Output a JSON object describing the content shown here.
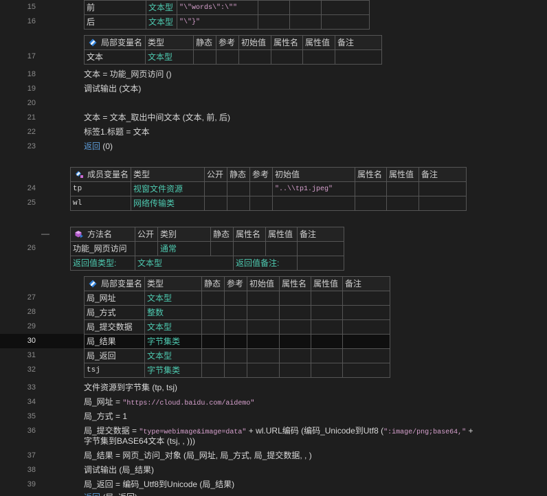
{
  "colors": {
    "background": "#1e1e1e",
    "line_number": "#8b8b8b",
    "code_text": "#d8d8d8",
    "type_text": "#4ec9b0",
    "string_text": "#d6a0cd",
    "keyword_text": "#5c9ad6",
    "grid_line": "#555555",
    "current_line": "#0f0f0f"
  },
  "icons": {
    "local_variables": "local-variable-icon",
    "member_variables": "member-variable-icon",
    "method": "method-icon",
    "fold": "fold-collapse-icon"
  },
  "param_table": {
    "rows": [
      {
        "line": "15",
        "name": "前",
        "type": "文本型",
        "value": "\"\\\"words\\\":\\\"\""
      },
      {
        "line": "16",
        "name": "后",
        "type": "文本型",
        "value": "\"\\\"}\""
      }
    ]
  },
  "sub_locals": {
    "headers": [
      "局部变量名",
      "类型",
      "静态",
      "参考",
      "初始值",
      "属性名",
      "属性值",
      "备注"
    ],
    "rows": [
      {
        "line": "17",
        "name": "文本",
        "type": "文本型"
      }
    ]
  },
  "code_a": {
    "l18": {
      "num": "18",
      "text": "文本 = 功能_网页访问 ()"
    },
    "l19": {
      "num": "19",
      "text": "调试输出 (文本)"
    },
    "l20": {
      "num": "20"
    },
    "l21": {
      "num": "21",
      "text": "文本 = 文本_取出中间文本 (文本, 前, 后)"
    },
    "l22": {
      "num": "22",
      "text": "标签1.标题 = 文本"
    },
    "l23": {
      "num": "23",
      "keyword": "返回",
      "text": " (0)"
    }
  },
  "member_vars": {
    "headers": [
      "成员变量名",
      "类型",
      "公开",
      "静态",
      "参考",
      "初始值",
      "属性名",
      "属性值",
      "备注"
    ],
    "rows": [
      {
        "line": "24",
        "name": "tp",
        "type": "视窗文件资源",
        "init": "\"..\\\\tp1.jpeg\""
      },
      {
        "line": "25",
        "name": "wl",
        "type": "网络传输类"
      }
    ]
  },
  "method": {
    "fold_marker": "—",
    "headers": [
      "方法名",
      "公开",
      "类别",
      "静态",
      "属性名",
      "属性值",
      "备注"
    ],
    "line": "26",
    "name": "功能_网页访问",
    "category": "通常",
    "return_type_label": "返回值类型:",
    "return_type": "文本型",
    "return_note_label": "返回值备注:"
  },
  "method_locals": {
    "headers": [
      "局部变量名",
      "类型",
      "静态",
      "参考",
      "初始值",
      "属性名",
      "属性值",
      "备注"
    ],
    "rows": [
      {
        "line": "27",
        "name": "局_网址",
        "type": "文本型"
      },
      {
        "line": "28",
        "name": "局_方式",
        "type": "整数"
      },
      {
        "line": "29",
        "name": "局_提交数据",
        "type": "文本型"
      },
      {
        "line": "30",
        "name": "局_结果",
        "type": "字节集类"
      },
      {
        "line": "31",
        "name": "局_返回",
        "type": "文本型"
      },
      {
        "line": "32",
        "name": "tsj",
        "type": "字节集类"
      }
    ]
  },
  "code_b": {
    "l33": {
      "num": "33",
      "text": "文件资源到字节集 (tp, tsj)"
    },
    "l34": {
      "num": "34",
      "text": "局_网址 = ",
      "string": "\"https://cloud.baidu.com/aidemo\""
    },
    "l35": {
      "num": "35",
      "text": "局_方式 = 1"
    },
    "l36": {
      "num": "36",
      "part1": "局_提交数据 = ",
      "string1": "\"type=webimage&image=data\"",
      "part2": " + wl.URL编码 (编码_Unicode到Utf8 (",
      "string2": "\":image/png;base64,\"",
      "part3": " +",
      "continuation": "字节集到BASE64文本 (tsj, , )))"
    },
    "l37": {
      "num": "37",
      "text": "局_结果 = 网页_访问_对象 (局_网址, 局_方式, 局_提交数据, , )"
    },
    "l38": {
      "num": "38",
      "text": "调试输出 (局_结果)"
    },
    "l39": {
      "num": "39",
      "text": "局_返回 = 编码_Utf8到Unicode (局_结果)"
    },
    "l40": {
      "keyword": "返回",
      "text": " (局_返回)"
    }
  }
}
